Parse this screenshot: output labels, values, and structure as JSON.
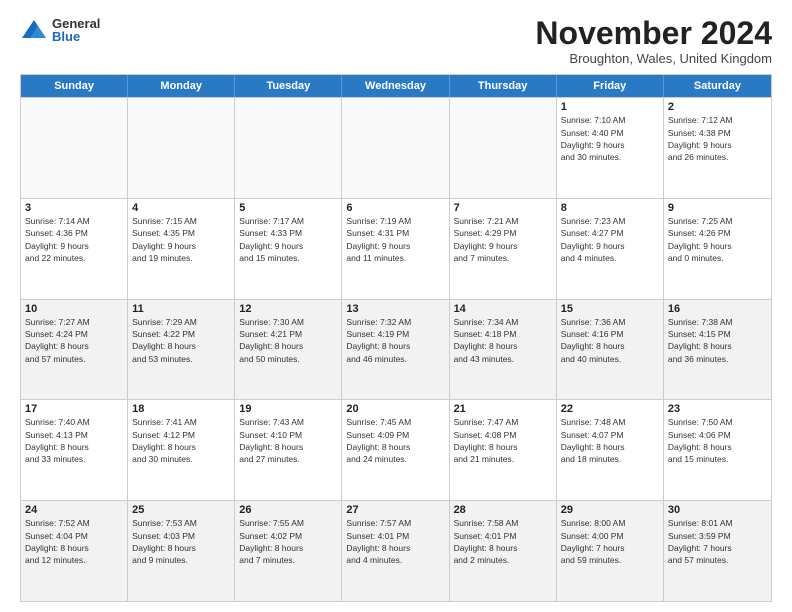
{
  "logo": {
    "general": "General",
    "blue": "Blue"
  },
  "title": "November 2024",
  "location": "Broughton, Wales, United Kingdom",
  "header_days": [
    "Sunday",
    "Monday",
    "Tuesday",
    "Wednesday",
    "Thursday",
    "Friday",
    "Saturday"
  ],
  "rows": [
    [
      {
        "day": "",
        "info": "",
        "empty": true
      },
      {
        "day": "",
        "info": "",
        "empty": true
      },
      {
        "day": "",
        "info": "",
        "empty": true
      },
      {
        "day": "",
        "info": "",
        "empty": true
      },
      {
        "day": "",
        "info": "",
        "empty": true
      },
      {
        "day": "1",
        "info": "Sunrise: 7:10 AM\nSunset: 4:40 PM\nDaylight: 9 hours\nand 30 minutes."
      },
      {
        "day": "2",
        "info": "Sunrise: 7:12 AM\nSunset: 4:38 PM\nDaylight: 9 hours\nand 26 minutes."
      }
    ],
    [
      {
        "day": "3",
        "info": "Sunrise: 7:14 AM\nSunset: 4:36 PM\nDaylight: 9 hours\nand 22 minutes."
      },
      {
        "day": "4",
        "info": "Sunrise: 7:15 AM\nSunset: 4:35 PM\nDaylight: 9 hours\nand 19 minutes."
      },
      {
        "day": "5",
        "info": "Sunrise: 7:17 AM\nSunset: 4:33 PM\nDaylight: 9 hours\nand 15 minutes."
      },
      {
        "day": "6",
        "info": "Sunrise: 7:19 AM\nSunset: 4:31 PM\nDaylight: 9 hours\nand 11 minutes."
      },
      {
        "day": "7",
        "info": "Sunrise: 7:21 AM\nSunset: 4:29 PM\nDaylight: 9 hours\nand 7 minutes."
      },
      {
        "day": "8",
        "info": "Sunrise: 7:23 AM\nSunset: 4:27 PM\nDaylight: 9 hours\nand 4 minutes."
      },
      {
        "day": "9",
        "info": "Sunrise: 7:25 AM\nSunset: 4:26 PM\nDaylight: 9 hours\nand 0 minutes."
      }
    ],
    [
      {
        "day": "10",
        "info": "Sunrise: 7:27 AM\nSunset: 4:24 PM\nDaylight: 8 hours\nand 57 minutes.",
        "shaded": true
      },
      {
        "day": "11",
        "info": "Sunrise: 7:29 AM\nSunset: 4:22 PM\nDaylight: 8 hours\nand 53 minutes.",
        "shaded": true
      },
      {
        "day": "12",
        "info": "Sunrise: 7:30 AM\nSunset: 4:21 PM\nDaylight: 8 hours\nand 50 minutes.",
        "shaded": true
      },
      {
        "day": "13",
        "info": "Sunrise: 7:32 AM\nSunset: 4:19 PM\nDaylight: 8 hours\nand 46 minutes.",
        "shaded": true
      },
      {
        "day": "14",
        "info": "Sunrise: 7:34 AM\nSunset: 4:18 PM\nDaylight: 8 hours\nand 43 minutes.",
        "shaded": true
      },
      {
        "day": "15",
        "info": "Sunrise: 7:36 AM\nSunset: 4:16 PM\nDaylight: 8 hours\nand 40 minutes.",
        "shaded": true
      },
      {
        "day": "16",
        "info": "Sunrise: 7:38 AM\nSunset: 4:15 PM\nDaylight: 8 hours\nand 36 minutes.",
        "shaded": true
      }
    ],
    [
      {
        "day": "17",
        "info": "Sunrise: 7:40 AM\nSunset: 4:13 PM\nDaylight: 8 hours\nand 33 minutes."
      },
      {
        "day": "18",
        "info": "Sunrise: 7:41 AM\nSunset: 4:12 PM\nDaylight: 8 hours\nand 30 minutes."
      },
      {
        "day": "19",
        "info": "Sunrise: 7:43 AM\nSunset: 4:10 PM\nDaylight: 8 hours\nand 27 minutes."
      },
      {
        "day": "20",
        "info": "Sunrise: 7:45 AM\nSunset: 4:09 PM\nDaylight: 8 hours\nand 24 minutes."
      },
      {
        "day": "21",
        "info": "Sunrise: 7:47 AM\nSunset: 4:08 PM\nDaylight: 8 hours\nand 21 minutes."
      },
      {
        "day": "22",
        "info": "Sunrise: 7:48 AM\nSunset: 4:07 PM\nDaylight: 8 hours\nand 18 minutes."
      },
      {
        "day": "23",
        "info": "Sunrise: 7:50 AM\nSunset: 4:06 PM\nDaylight: 8 hours\nand 15 minutes."
      }
    ],
    [
      {
        "day": "24",
        "info": "Sunrise: 7:52 AM\nSunset: 4:04 PM\nDaylight: 8 hours\nand 12 minutes.",
        "shaded": true
      },
      {
        "day": "25",
        "info": "Sunrise: 7:53 AM\nSunset: 4:03 PM\nDaylight: 8 hours\nand 9 minutes.",
        "shaded": true
      },
      {
        "day": "26",
        "info": "Sunrise: 7:55 AM\nSunset: 4:02 PM\nDaylight: 8 hours\nand 7 minutes.",
        "shaded": true
      },
      {
        "day": "27",
        "info": "Sunrise: 7:57 AM\nSunset: 4:01 PM\nDaylight: 8 hours\nand 4 minutes.",
        "shaded": true
      },
      {
        "day": "28",
        "info": "Sunrise: 7:58 AM\nSunset: 4:01 PM\nDaylight: 8 hours\nand 2 minutes.",
        "shaded": true
      },
      {
        "day": "29",
        "info": "Sunrise: 8:00 AM\nSunset: 4:00 PM\nDaylight: 7 hours\nand 59 minutes.",
        "shaded": true
      },
      {
        "day": "30",
        "info": "Sunrise: 8:01 AM\nSunset: 3:59 PM\nDaylight: 7 hours\nand 57 minutes.",
        "shaded": true
      }
    ]
  ]
}
